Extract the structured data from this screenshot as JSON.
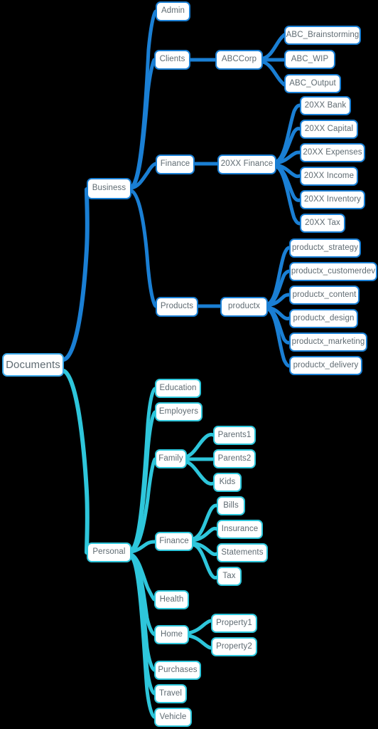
{
  "diagram": {
    "title": "Documents",
    "type": "mind-map",
    "background": "#000000",
    "colors": {
      "business_branch": "#1a7fd4",
      "personal_branch": "#2ec6db",
      "root_border": "#3aa8e8",
      "node_fill": "#ffffff",
      "node_text": "#5f6b72"
    }
  },
  "nodes": {
    "root": {
      "label": "Documents"
    },
    "business": {
      "label": "Business"
    },
    "personal": {
      "label": "Personal"
    },
    "admin": {
      "label": "Admin"
    },
    "clients": {
      "label": "Clients"
    },
    "abccorp": {
      "label": "ABCCorp"
    },
    "abc_brainstorming": {
      "label": "ABC_Brainstorming"
    },
    "abc_wip": {
      "label": "ABC_WIP"
    },
    "abc_output": {
      "label": "ABC_Output"
    },
    "finance_biz": {
      "label": "Finance"
    },
    "finance_20xx": {
      "label": "20XX Finance"
    },
    "bank_20xx": {
      "label": "20XX Bank"
    },
    "capital_20xx": {
      "label": "20XX Capital"
    },
    "expenses_20xx": {
      "label": "20XX Expenses"
    },
    "income_20xx": {
      "label": "20XX Income"
    },
    "inventory_20xx": {
      "label": "20XX Inventory"
    },
    "tax_20xx": {
      "label": "20XX Tax"
    },
    "products": {
      "label": "Products"
    },
    "productx": {
      "label": "productx"
    },
    "productx_strategy": {
      "label": "productx_strategy"
    },
    "productx_customerdev": {
      "label": "productx_customerdev"
    },
    "productx_content": {
      "label": "productx_content"
    },
    "productx_design": {
      "label": "productx_design"
    },
    "productx_marketing": {
      "label": "productx_marketing"
    },
    "productx_delivery": {
      "label": "productx_delivery"
    },
    "education": {
      "label": "Education"
    },
    "employers": {
      "label": "Employers"
    },
    "family": {
      "label": "Family"
    },
    "parents1": {
      "label": "Parents1"
    },
    "parents2": {
      "label": "Parents2"
    },
    "kids": {
      "label": "Kids"
    },
    "finance_personal": {
      "label": "Finance"
    },
    "bills": {
      "label": "Bills"
    },
    "insurance": {
      "label": "Insurance"
    },
    "statements": {
      "label": "Statements"
    },
    "tax_personal": {
      "label": "Tax"
    },
    "health": {
      "label": "Health"
    },
    "home": {
      "label": "Home"
    },
    "property1": {
      "label": "Property1"
    },
    "property2": {
      "label": "Property2"
    },
    "purchases": {
      "label": "Purchases"
    },
    "travel": {
      "label": "Travel"
    },
    "vehicle": {
      "label": "Vehicle"
    }
  },
  "chart_data": {
    "type": "tree",
    "title": "Documents",
    "root": "Documents",
    "edges": [
      [
        "Documents",
        "Business"
      ],
      [
        "Documents",
        "Personal"
      ],
      [
        "Business",
        "Admin"
      ],
      [
        "Business",
        "Clients"
      ],
      [
        "Business",
        "Finance"
      ],
      [
        "Business",
        "Products"
      ],
      [
        "Clients",
        "ABCCorp"
      ],
      [
        "ABCCorp",
        "ABC_Brainstorming"
      ],
      [
        "ABCCorp",
        "ABC_WIP"
      ],
      [
        "ABCCorp",
        "ABC_Output"
      ],
      [
        "Finance",
        "20XX Finance"
      ],
      [
        "20XX Finance",
        "20XX Bank"
      ],
      [
        "20XX Finance",
        "20XX Capital"
      ],
      [
        "20XX Finance",
        "20XX Expenses"
      ],
      [
        "20XX Finance",
        "20XX Income"
      ],
      [
        "20XX Finance",
        "20XX Inventory"
      ],
      [
        "20XX Finance",
        "20XX Tax"
      ],
      [
        "Products",
        "productx"
      ],
      [
        "productx",
        "productx_strategy"
      ],
      [
        "productx",
        "productx_customerdev"
      ],
      [
        "productx",
        "productx_content"
      ],
      [
        "productx",
        "productx_design"
      ],
      [
        "productx",
        "productx_marketing"
      ],
      [
        "productx",
        "productx_delivery"
      ],
      [
        "Personal",
        "Education"
      ],
      [
        "Personal",
        "Employers"
      ],
      [
        "Personal",
        "Family"
      ],
      [
        "Family",
        "Parents1"
      ],
      [
        "Family",
        "Parents2"
      ],
      [
        "Family",
        "Kids"
      ],
      [
        "Personal",
        "Finance"
      ],
      [
        "Finance",
        "Bills"
      ],
      [
        "Finance",
        "Insurance"
      ],
      [
        "Finance",
        "Statements"
      ],
      [
        "Finance",
        "Tax"
      ],
      [
        "Personal",
        "Health"
      ],
      [
        "Personal",
        "Home"
      ],
      [
        "Home",
        "Property1"
      ],
      [
        "Home",
        "Property2"
      ],
      [
        "Personal",
        "Purchases"
      ],
      [
        "Personal",
        "Travel"
      ],
      [
        "Personal",
        "Vehicle"
      ]
    ]
  }
}
